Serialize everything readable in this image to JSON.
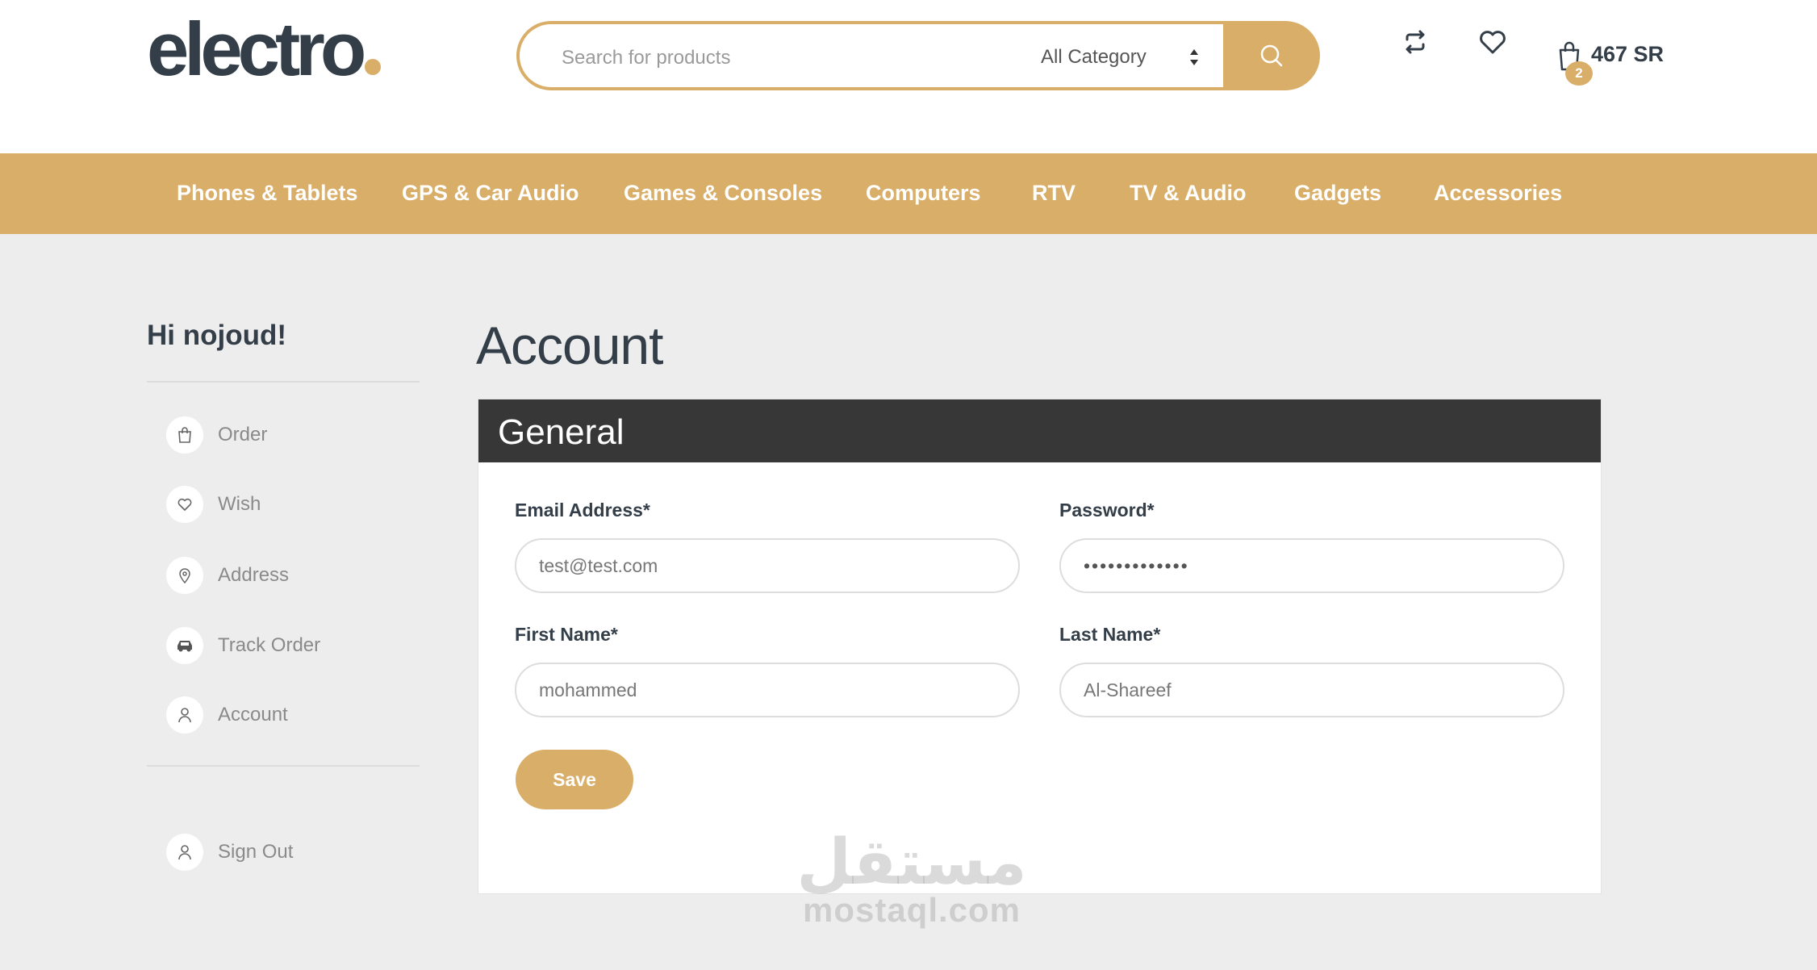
{
  "brand": {
    "logo_text": "electro",
    "accent_color": "#d9ae68",
    "dark_color": "#333e48"
  },
  "search": {
    "placeholder": "Search for products",
    "value": "",
    "category": "All Category"
  },
  "header_icons": [
    "compare-icon",
    "heart-icon",
    "shopping-bag-icon"
  ],
  "cart": {
    "count": "2",
    "total": "467 SR"
  },
  "nav": {
    "items": [
      {
        "label": "Phones & Tablets"
      },
      {
        "label": "GPS & Car Audio"
      },
      {
        "label": "Games & Consoles"
      },
      {
        "label": "Computers"
      },
      {
        "label": "RTV"
      },
      {
        "label": "TV & Audio"
      },
      {
        "label": "Gadgets"
      },
      {
        "label": "Accessories"
      }
    ]
  },
  "sidebar": {
    "greeting": "Hi nojoud!",
    "items": [
      {
        "label": "Order",
        "icon": "bag-icon"
      },
      {
        "label": "Wish",
        "icon": "heart-icon"
      },
      {
        "label": "Address",
        "icon": "map-pin-icon"
      },
      {
        "label": "Track Order",
        "icon": "car-icon"
      },
      {
        "label": "Account",
        "icon": "user-icon"
      }
    ],
    "sign_out": {
      "label": "Sign Out",
      "icon": "user-icon"
    }
  },
  "main": {
    "title": "Account",
    "section_title": "General",
    "fields": {
      "email": {
        "label": "Email Address*",
        "value": "test@test.com"
      },
      "password": {
        "label": "Password*",
        "value": "•••••••••••••"
      },
      "first_name": {
        "label": "First Name*",
        "value": "mohammed"
      },
      "last_name": {
        "label": "Last Name*",
        "value": "Al-Shareef"
      }
    },
    "save_label": "Save"
  },
  "watermark": {
    "arabic": "مستقل",
    "latin": "mostaql.com"
  }
}
